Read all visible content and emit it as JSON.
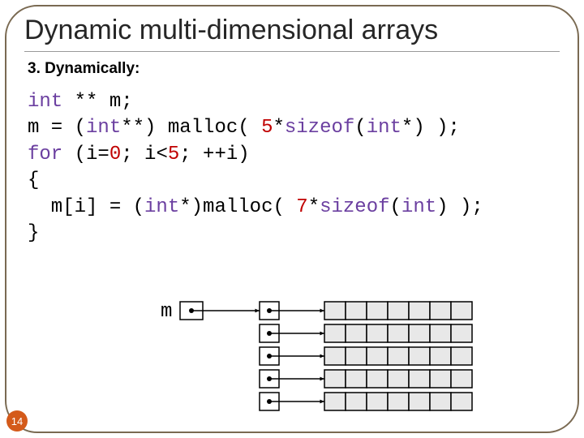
{
  "title": "Dynamic multi-dimensional arrays",
  "subtitle": "3. Dynamically:",
  "code": {
    "l1a": "int",
    "l1b": " ** m;",
    "l2a": "m = (",
    "l2b": "int",
    "l2c": "**) malloc( ",
    "l2d": "5",
    "l2e": "*",
    "l2f": "sizeof",
    "l2g": "(",
    "l2h": "int",
    "l2i": "*) );",
    "l3a": "for",
    "l3b": " (i=",
    "l3c": "0",
    "l3d": "; i<",
    "l3e": "5",
    "l3f": "; ++i)",
    "l4": "{",
    "l5a": "  m[i] = (",
    "l5b": "int",
    "l5c": "*)malloc( ",
    "l5d": "7",
    "l5e": "*",
    "l5f": "sizeof",
    "l5g": "(",
    "l5h": "int",
    "l5i": ") );",
    "l6": "}"
  },
  "diagram": {
    "label": "m",
    "ptr_rows": 5,
    "row_cells": 7
  },
  "page_number": "14"
}
